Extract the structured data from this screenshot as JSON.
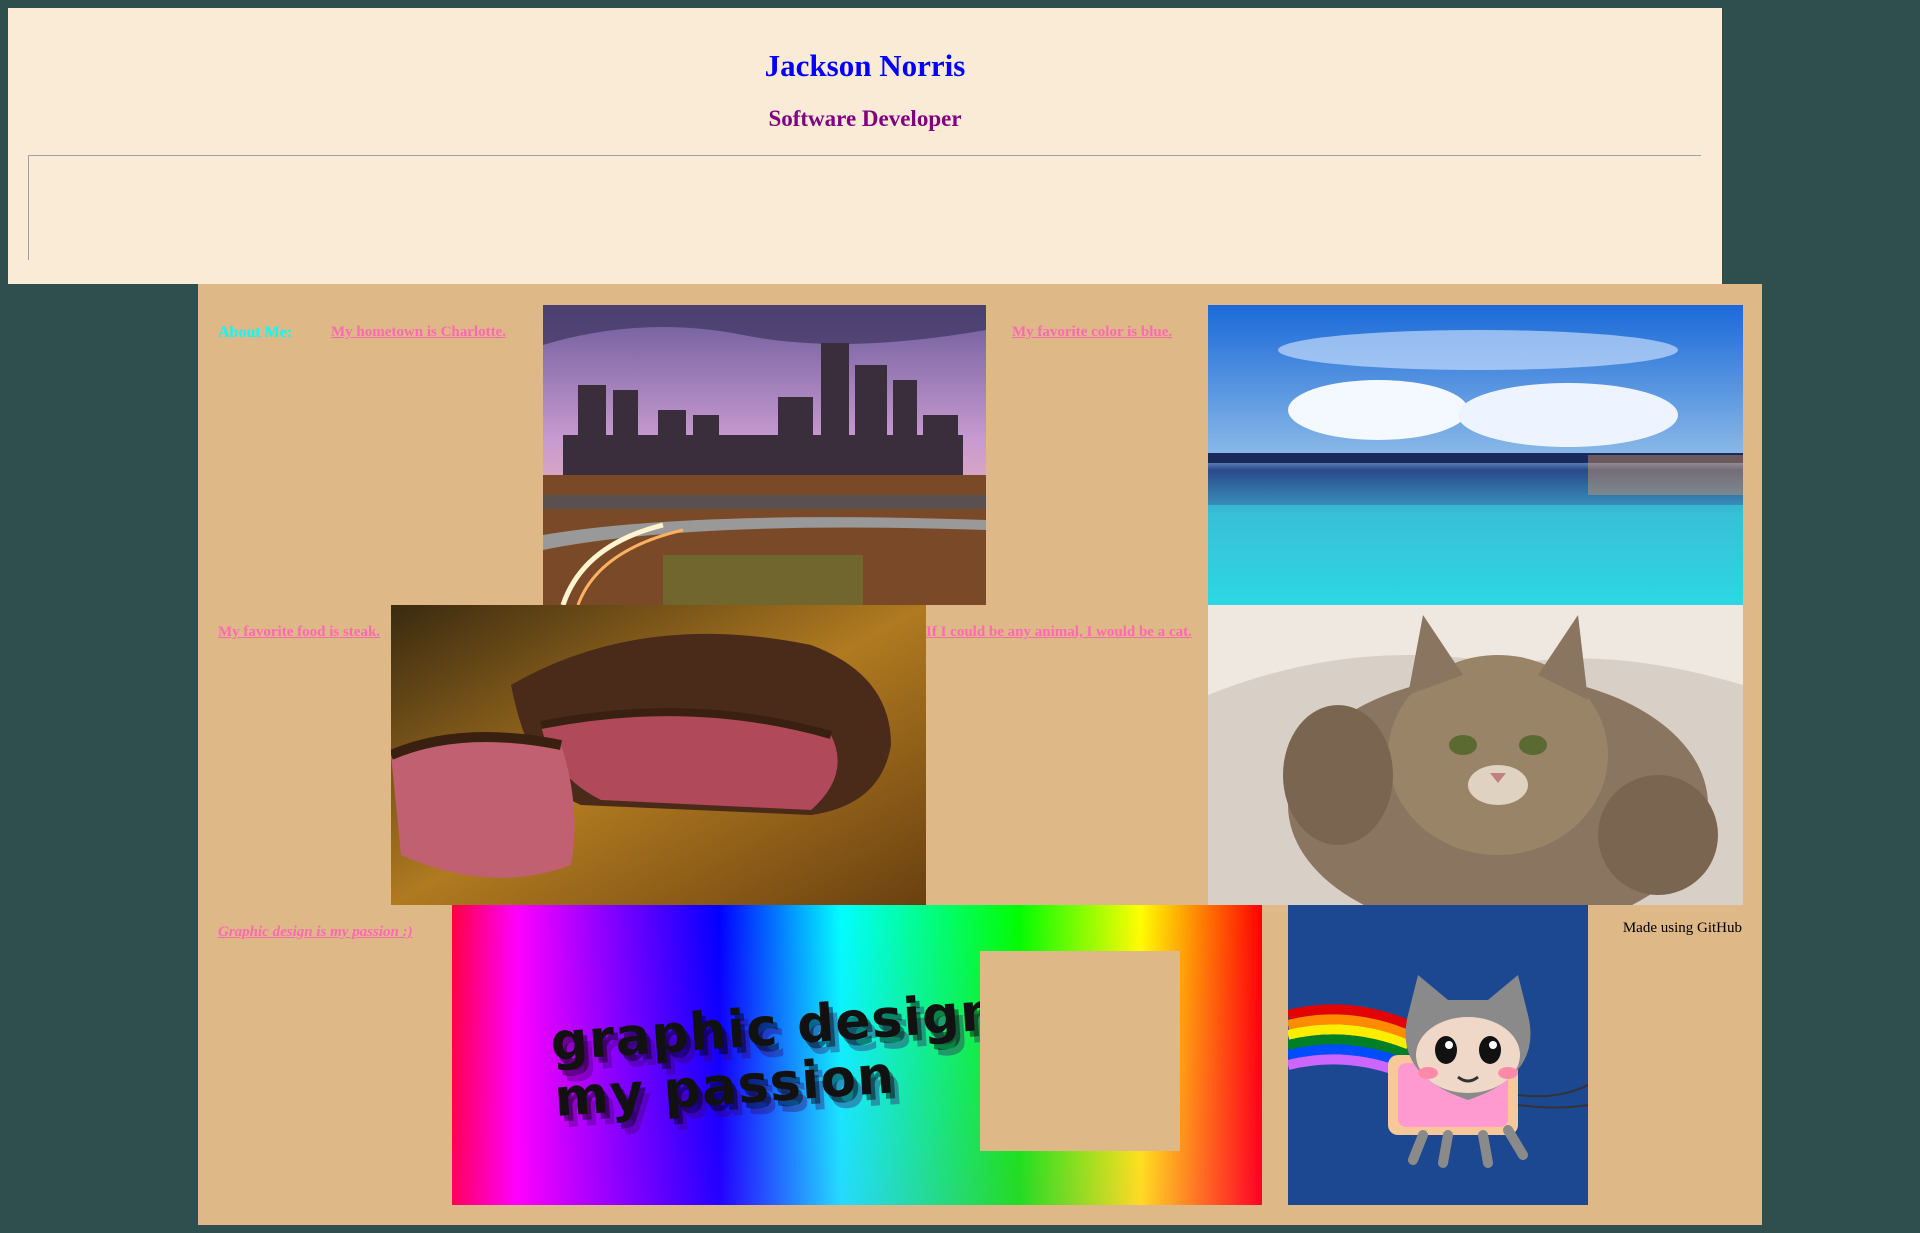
{
  "header": {
    "name": "Jackson Norris",
    "title": "Software Developer"
  },
  "about": {
    "label": "About Me:",
    "facts": {
      "hometown": "My hometown is Charlotte.",
      "color": "My favorite color is blue.",
      "food": "My favorite food is steak.",
      "animal": "If I could be any animal, I would be a cat.",
      "passion": "Graphic design is my passion :)"
    },
    "credit": "Made using GitHub"
  },
  "images": {
    "charlotte": "charlotte-skyline-image",
    "ocean": "blue-ocean-sky-image",
    "steak": "steak-image",
    "cat": "cat-image",
    "graphic_design": "graphic-design-meme-image",
    "octocat": "nyan-octocat-image"
  },
  "colors": {
    "page_background": "#2f4f4f",
    "header_background": "#faebd7",
    "content_background": "#deb887",
    "name_color": "#0000ff",
    "title_color": "#800080",
    "about_color": "#00ffff",
    "fact_color": "#ff69b4"
  }
}
